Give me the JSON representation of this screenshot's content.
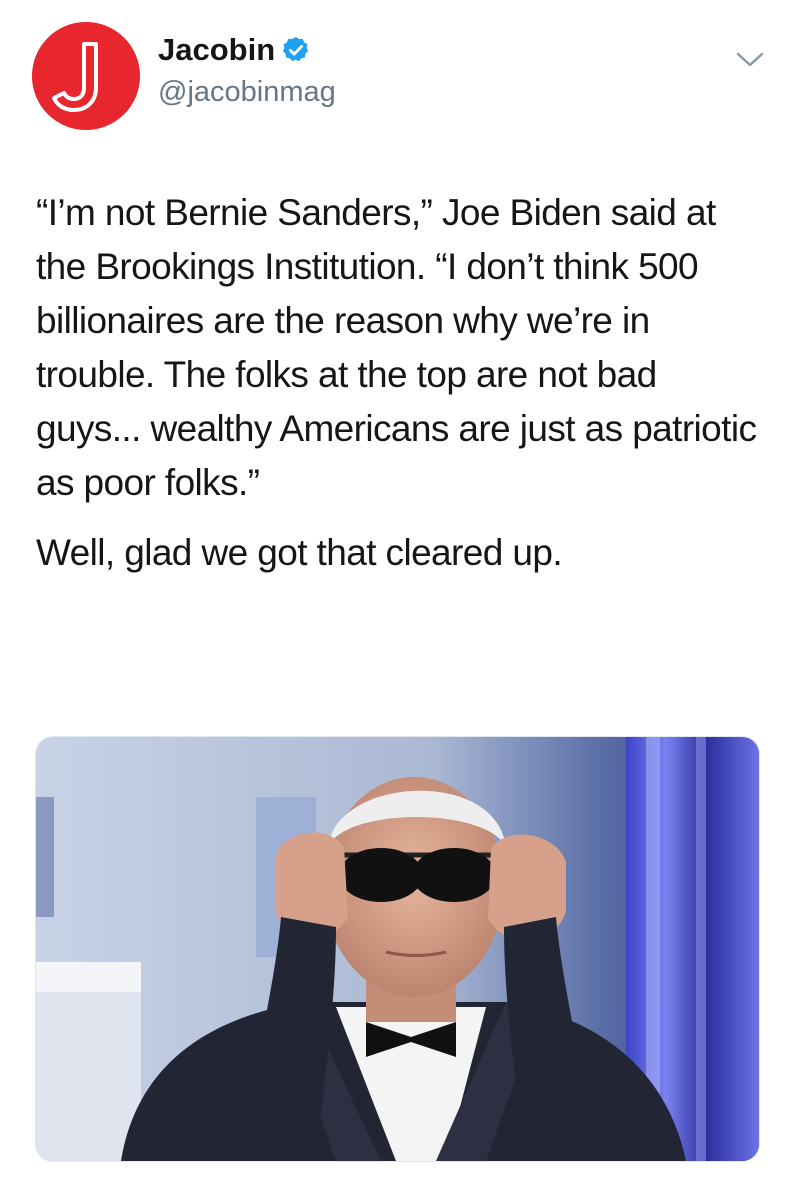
{
  "tweet": {
    "author": {
      "display_name": "Jacobin",
      "handle": "@jacobinmag",
      "verified": true,
      "avatar_letter": "J",
      "avatar_color": "#e8262d"
    },
    "menu_icon": "chevron-down-icon",
    "text": {
      "quote": "“I’m not Bernie Sanders,” Joe Biden said at the Brookings Institution. “I don’t think 500 billionaires are the reason why we’re in trouble. The folks at the top are not bad guys... wealthy Americans are just as patriotic as poor folks.”",
      "comment": "Well, glad we got that cleared up."
    },
    "colors": {
      "verified_blue": "#1da1f2",
      "handle_gray": "#657786",
      "text_dark": "#14171a"
    }
  }
}
